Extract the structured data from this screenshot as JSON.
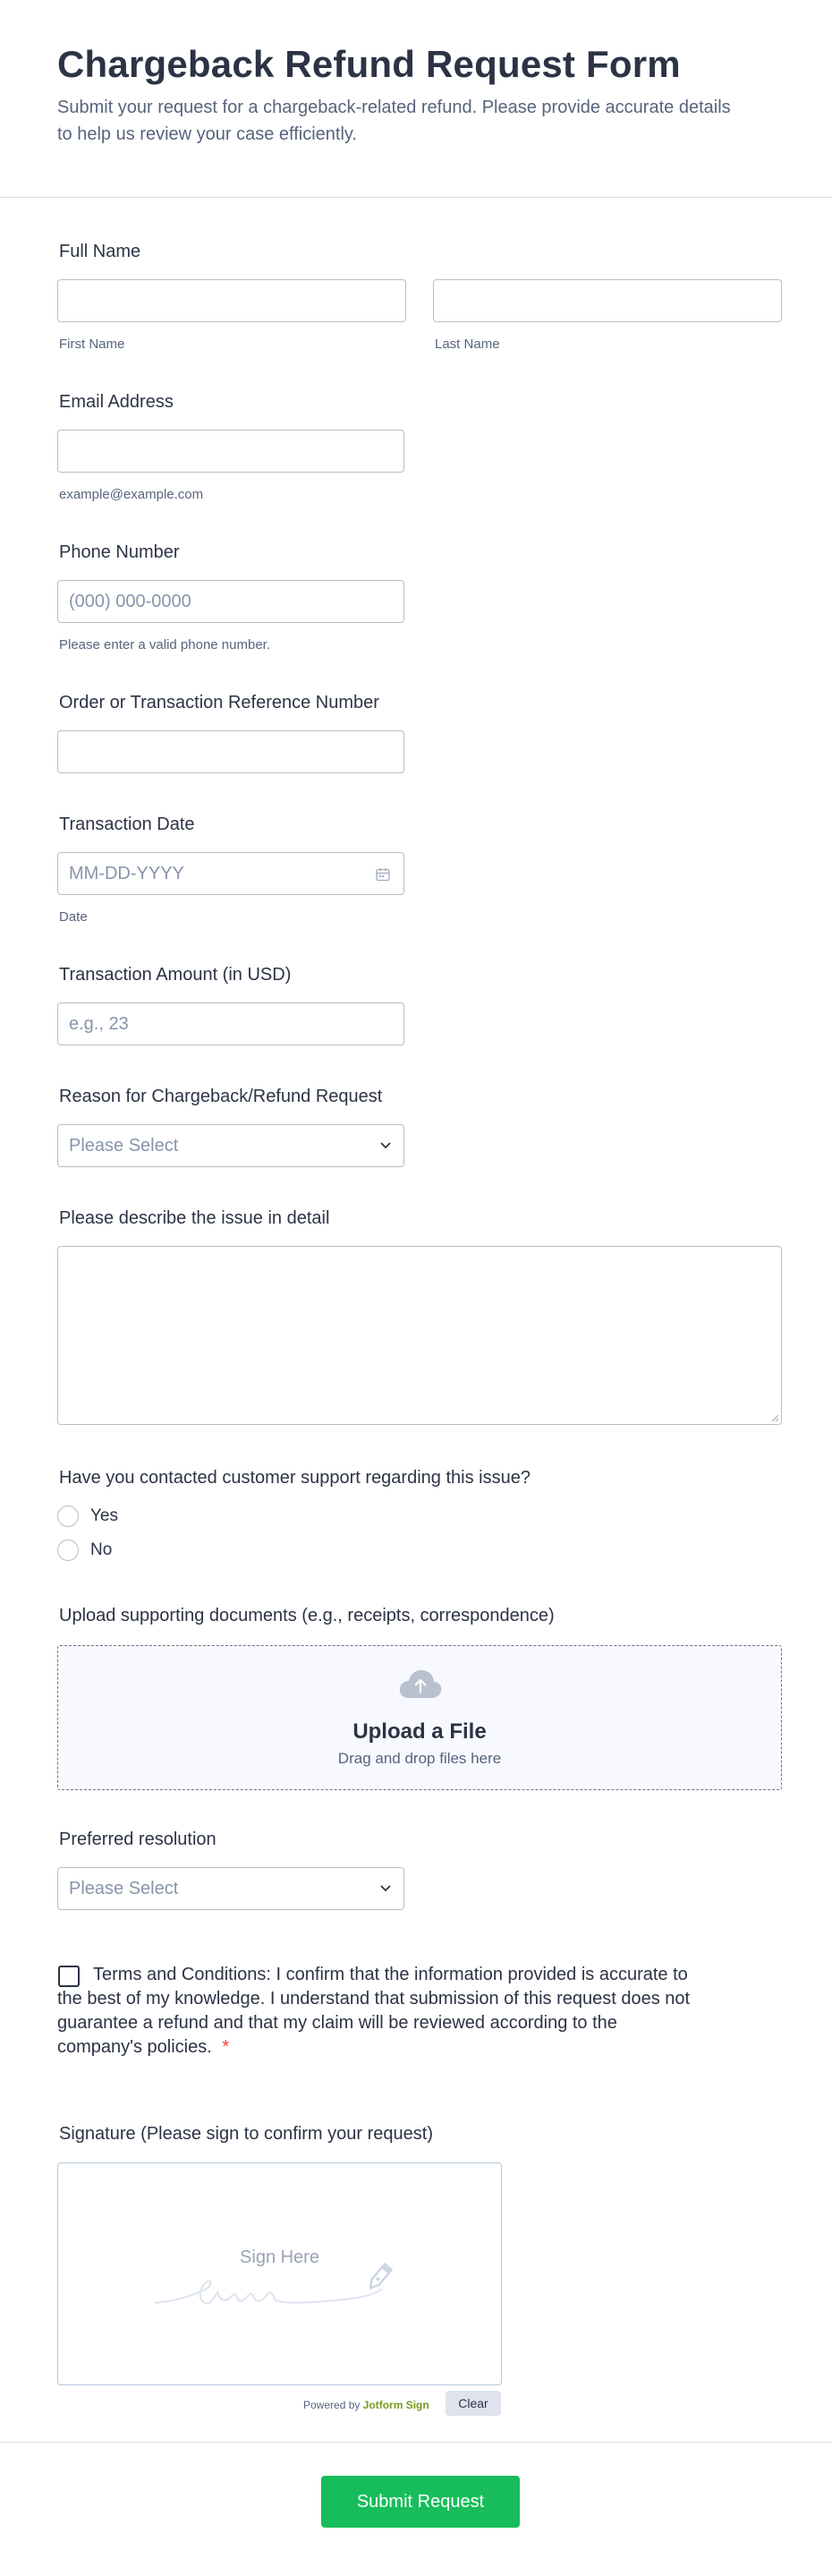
{
  "header": {
    "title": "Chargeback Refund Request Form",
    "subtitle": "Submit your request for a chargeback-related refund. Please provide accurate details to help us review your case efficiently."
  },
  "full_name": {
    "label": "Full Name",
    "first_sublabel": "First Name",
    "last_sublabel": "Last Name"
  },
  "email": {
    "label": "Email Address",
    "sublabel": "example@example.com"
  },
  "phone": {
    "label": "Phone Number",
    "placeholder": "(000) 000-0000",
    "sublabel": "Please enter a valid phone number."
  },
  "order_ref": {
    "label": "Order or Transaction Reference Number"
  },
  "transaction_date": {
    "label": "Transaction Date",
    "placeholder": "MM-DD-YYYY",
    "sublabel": "Date",
    "icon": "calendar-icon"
  },
  "amount": {
    "label": "Transaction Amount (in USD)",
    "placeholder": "e.g., 23"
  },
  "reason": {
    "label": "Reason for Chargeback/Refund Request",
    "selected": "Please Select"
  },
  "description": {
    "label": "Please describe the issue in detail"
  },
  "contacted_support": {
    "label": "Have you contacted customer support regarding this issue?",
    "options": [
      "Yes",
      "No"
    ]
  },
  "upload": {
    "label": "Upload supporting documents (e.g., receipts, correspondence)",
    "title": "Upload a File",
    "subtitle": "Drag and drop files here",
    "icon": "cloud-upload-icon"
  },
  "resolution": {
    "label": "Preferred resolution",
    "selected": "Please Select"
  },
  "terms": {
    "text": "Terms and Conditions: I confirm that the information provided is accurate to the best of my knowledge. I understand that submission of this request does not guarantee a refund and that my claim will be reviewed according to the company's policies.",
    "required_mark": "*"
  },
  "signature": {
    "label": "Signature (Please sign to confirm your request)",
    "placeholder": "Sign Here",
    "powered_by": "Powered by",
    "brand": "Jotform Sign",
    "clear_label": "Clear"
  },
  "submit": {
    "label": "Submit Request"
  },
  "colors": {
    "accent": "#18bd5b",
    "text": "#2c3345",
    "muted": "#57647e",
    "required": "#f23a3c",
    "brand": "#7a9a1c"
  }
}
